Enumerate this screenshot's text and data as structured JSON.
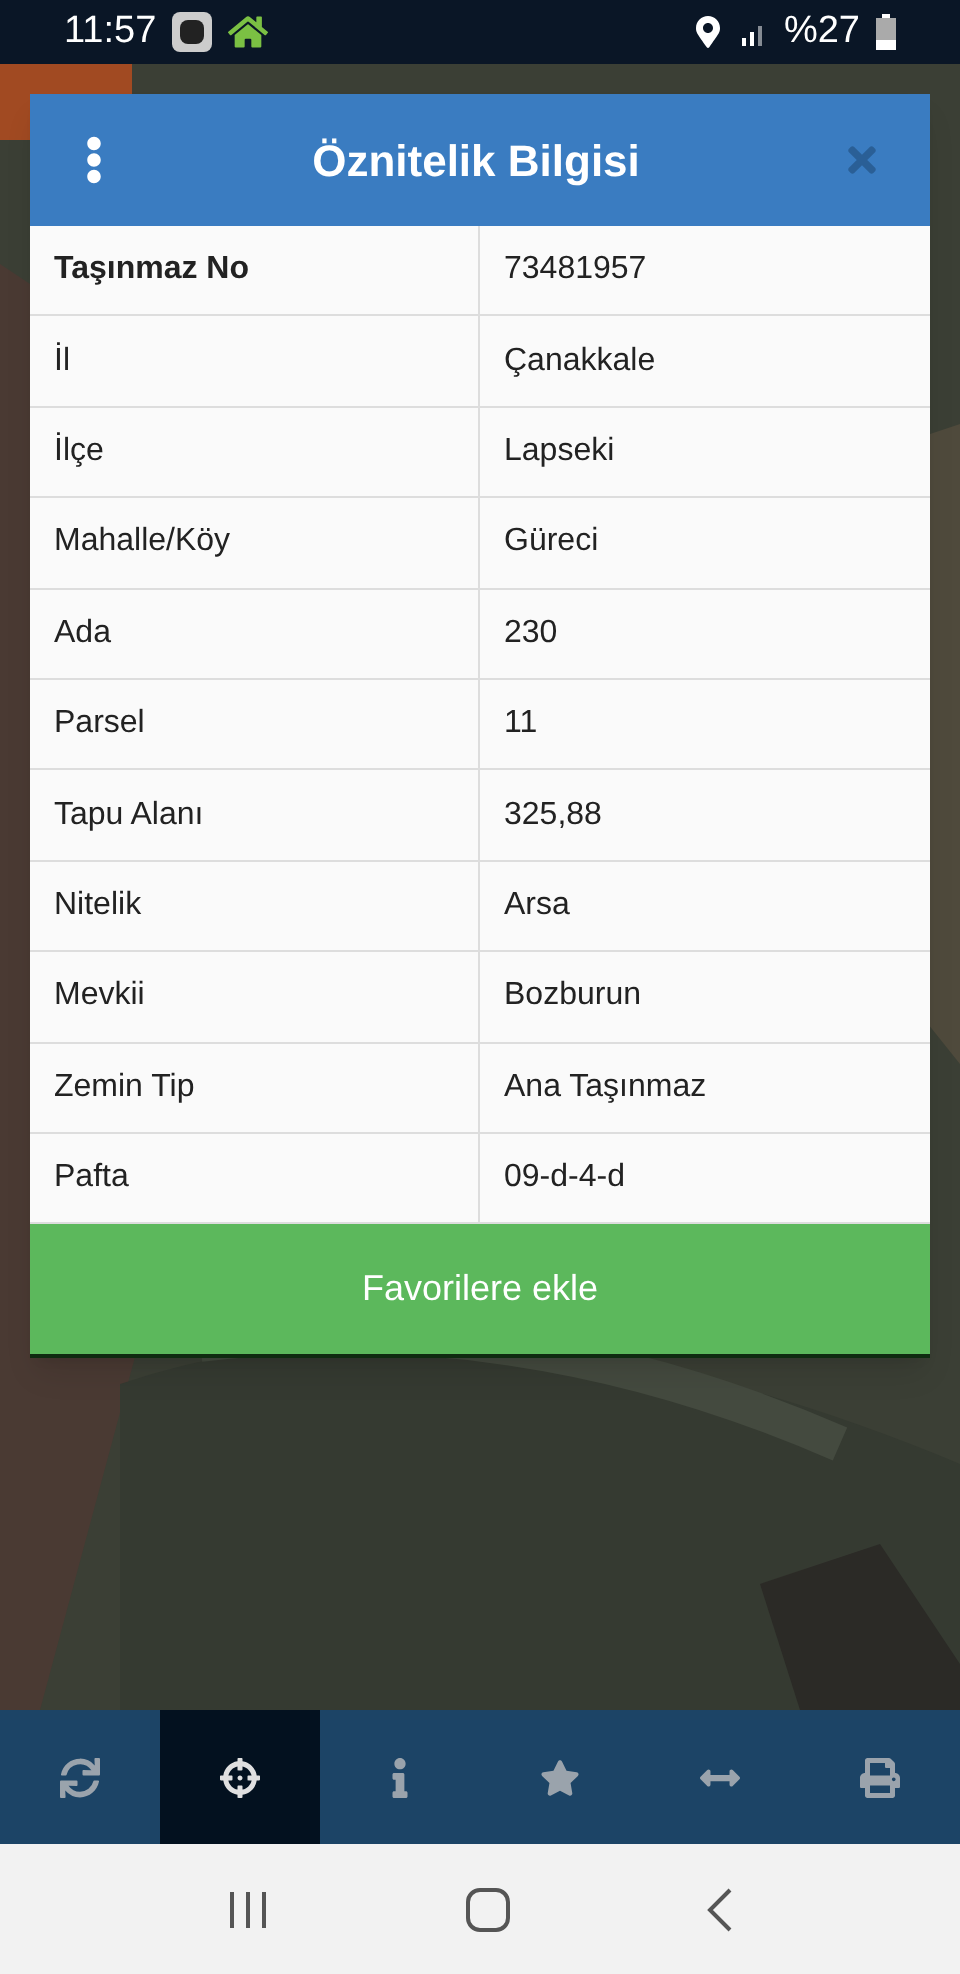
{
  "status_bar": {
    "time": "11:57",
    "battery": "%27"
  },
  "dialog": {
    "title": "Öznitelik Bilgisi",
    "rows": [
      {
        "label": "Taşınmaz No",
        "value": "73481957",
        "bold": true
      },
      {
        "label": "İl",
        "value": "Çanakkale",
        "bold": false
      },
      {
        "label": "İlçe",
        "value": "Lapseki",
        "bold": false
      },
      {
        "label": "Mahalle/Köy",
        "value": "Güreci",
        "bold": false
      },
      {
        "label": "Ada",
        "value": "230",
        "bold": false
      },
      {
        "label": "Parsel",
        "value": "11",
        "bold": false
      },
      {
        "label": "Tapu Alanı",
        "value": "325,88",
        "bold": false
      },
      {
        "label": "Nitelik",
        "value": "Arsa",
        "bold": false
      },
      {
        "label": "Mevkii",
        "value": "Bozburun",
        "bold": false
      },
      {
        "label": "Zemin Tip",
        "value": "Ana Taşınmaz",
        "bold": false
      },
      {
        "label": "Pafta",
        "value": "09-d-4-d",
        "bold": false
      }
    ],
    "button": "Favorilere ekle"
  },
  "toolbar": [
    {
      "kind": "refresh",
      "selected": false
    },
    {
      "kind": "locate",
      "selected": true
    },
    {
      "kind": "info",
      "selected": false
    },
    {
      "kind": "star",
      "selected": false
    },
    {
      "kind": "measure",
      "selected": false
    },
    {
      "kind": "print",
      "selected": false
    }
  ]
}
